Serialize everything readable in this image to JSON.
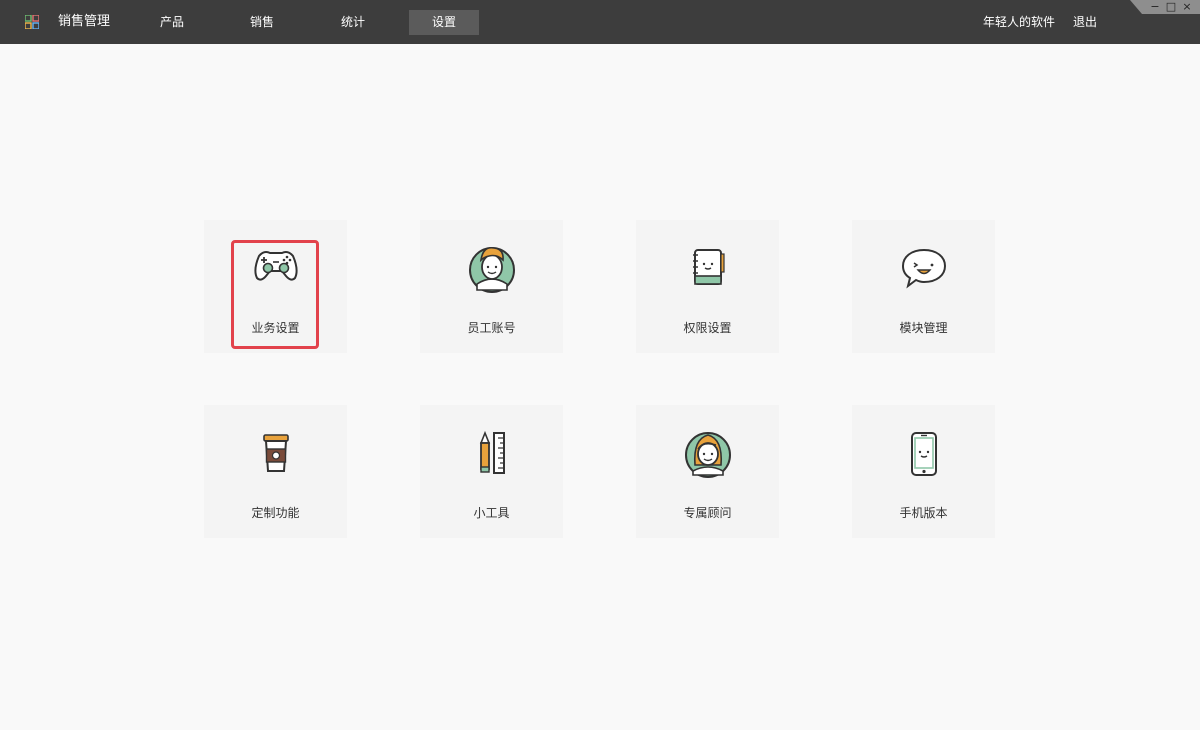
{
  "app": {
    "title": "销售管理"
  },
  "nav": [
    {
      "label": "产品",
      "active": false
    },
    {
      "label": "销售",
      "active": false
    },
    {
      "label": "统计",
      "active": false
    },
    {
      "label": "设置",
      "active": true
    }
  ],
  "top_links": {
    "brand": "年轻人的软件",
    "logout": "退出"
  },
  "window_controls": {
    "minimize": "−",
    "maximize": "□",
    "close": "×"
  },
  "tiles": [
    {
      "label": "业务设置",
      "icon": "gamepad-icon",
      "selected": true
    },
    {
      "label": "员工账号",
      "icon": "user-avatar-icon",
      "selected": false
    },
    {
      "label": "权限设置",
      "icon": "notebook-icon",
      "selected": false
    },
    {
      "label": "模块管理",
      "icon": "chat-bubble-icon",
      "selected": false
    },
    {
      "label": "定制功能",
      "icon": "coffee-cup-icon",
      "selected": false
    },
    {
      "label": "小工具",
      "icon": "pencil-ruler-icon",
      "selected": false
    },
    {
      "label": "专属顾问",
      "icon": "advisor-avatar-icon",
      "selected": false
    },
    {
      "label": "手机版本",
      "icon": "mobile-phone-icon",
      "selected": false
    }
  ],
  "colors": {
    "topbar": "#3d3d3d",
    "nav_active": "#5b5b5b",
    "background": "#f9f9f9",
    "tile": "#f4f4f4",
    "selection": "#e2424b",
    "icon_green": "#8fc7a8",
    "icon_orange": "#e8a23c"
  }
}
